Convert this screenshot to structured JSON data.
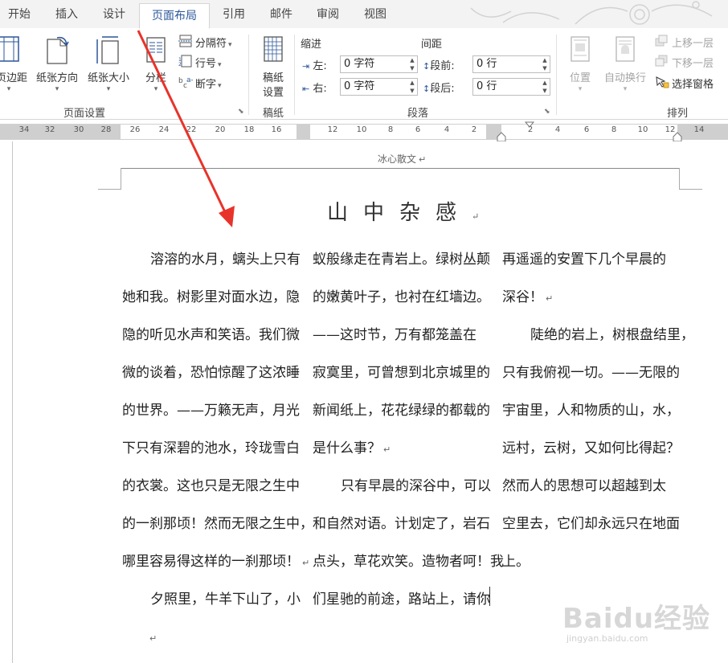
{
  "tabs": [
    {
      "label": "开始",
      "active": false
    },
    {
      "label": "插入",
      "active": false
    },
    {
      "label": "设计",
      "active": false
    },
    {
      "label": "页面布局",
      "active": true
    },
    {
      "label": "引用",
      "active": false
    },
    {
      "label": "邮件",
      "active": false
    },
    {
      "label": "审阅",
      "active": false
    },
    {
      "label": "视图",
      "active": false
    }
  ],
  "ribbon": {
    "page_setup": {
      "margins": "页边距",
      "orientation": "纸张方向",
      "size": "纸张大小",
      "columns": "分栏",
      "breaks": "分隔符",
      "line_numbers": "行号",
      "hyphenation": "断字",
      "group_label": "页面设置"
    },
    "manuscript": {
      "button_line1": "稿纸",
      "button_line2": "设置",
      "group_label": "稿纸"
    },
    "paragraph": {
      "indent_title": "缩进",
      "spacing_title": "间距",
      "left_label": "左:",
      "left_value": "0 字符",
      "right_label": "右:",
      "right_value": "0 字符",
      "before_label": "段前:",
      "before_value": "0 行",
      "after_label": "段后:",
      "after_value": "0 行",
      "group_label": "段落"
    },
    "arrange": {
      "position": "位置",
      "wrap_text": "自动换行",
      "bring_forward": "上移一层",
      "send_backward": "下移一层",
      "selection_pane": "选择窗格",
      "group_label": "排列"
    }
  },
  "ruler": {
    "left_numbers": [
      "34",
      "32",
      "30",
      "28",
      "26",
      "24",
      "22",
      "20",
      "18",
      "16",
      "14"
    ],
    "mid_numbers": [
      "12",
      "10",
      "8",
      "6",
      "4",
      "2"
    ],
    "right_numbers": [
      "2",
      "4",
      "6",
      "8",
      "10",
      "12",
      "14",
      "16"
    ]
  },
  "document": {
    "header": "冰心散文",
    "title": "山中杂感",
    "col1": [
      "溶溶的水月，螭头上只有",
      "她和我。树影里对面水边，隐",
      "隐的听见水声和笑语。我们微",
      "微的谈着，恐怕惊醒了这浓睡",
      "的世界。——万籁无声，月光",
      "下只有深碧的池水，玲珑雪白",
      "的衣裳。这也只是无限之生中",
      "的一刹那顷！然而无限之生中，",
      "哪里容易得这样的一刹那顷！",
      "夕照里，牛羊下山了，小"
    ],
    "col2": [
      "蚁般缘走在青岩上。绿树丛颠",
      "的嫩黄叶子，也衬在红墙边。",
      "——这时节，万有都笼盖在",
      "寂寞里，可曾想到北京城里的",
      "新闻纸上，花花绿绿的都载的",
      "是什么事？",
      "只有早晨的深谷中，可以",
      "和自然对语。计划定了，岩石",
      "点头，草花欢笑。造物者呵！我",
      "们星驰的前途，路站上，请你"
    ],
    "col3": [
      "再遥遥的安置下几个早晨的",
      "深谷！",
      "陡绝的岩上，树根盘结里，",
      "只有我俯视一切。——无限的",
      "宇宙里，人和物质的山，水，",
      "远村，云树，又如何比得起？",
      "然而人的思想可以超越到太",
      "空里去，它们却永远只在地面",
      "上。"
    ]
  },
  "watermark": {
    "brand": "Baidu经验",
    "url": "jingyan.baidu.com"
  },
  "colors": {
    "accent": "#2b579a",
    "annotation_arrow": "#e8332a"
  }
}
